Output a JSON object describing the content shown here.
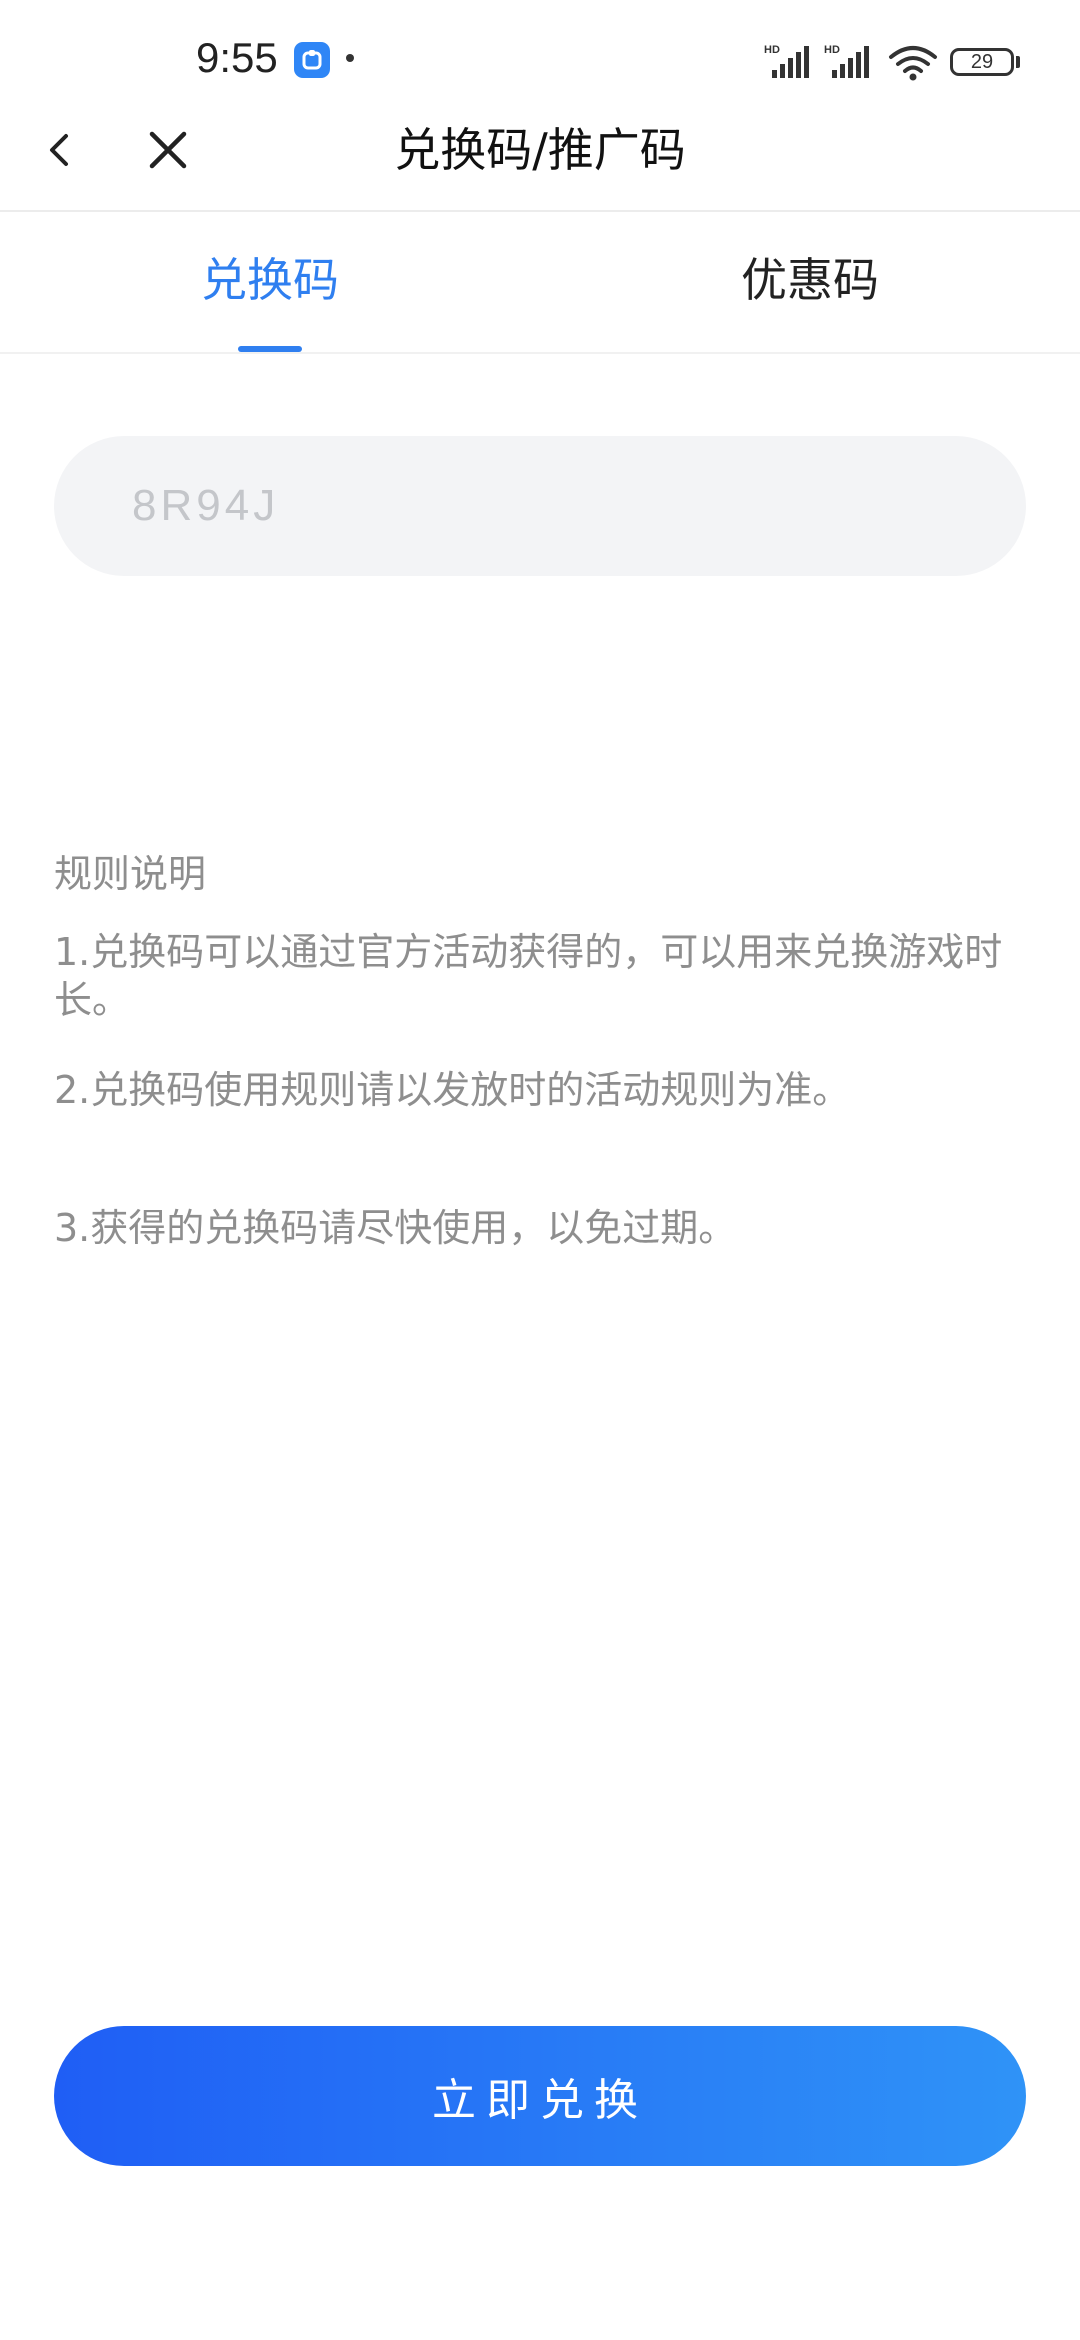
{
  "status_bar": {
    "time": "9:55",
    "battery": "29",
    "network_label": "HD"
  },
  "header": {
    "title": "兑换码/推广码"
  },
  "tabs": [
    {
      "label": "兑换码",
      "active": true
    },
    {
      "label": "优惠码",
      "active": false
    }
  ],
  "code_input": {
    "placeholder": "8R94J",
    "value": ""
  },
  "rules": {
    "title": "规则说明",
    "items": [
      "1.兑换码可以通过官方活动获得的，可以用来兑换游戏时长。",
      "2.兑换码使用规则请以发放时的活动规则为准。",
      "3.获得的兑换码请尽快使用，以免过期。"
    ]
  },
  "actions": {
    "redeem_label": "立即兑换"
  },
  "colors": {
    "accent": "#2f7ff0",
    "button_gradient_start": "#1f5ef5",
    "button_gradient_end": "#2f93f7",
    "rule_text": "#8e8e8e"
  }
}
